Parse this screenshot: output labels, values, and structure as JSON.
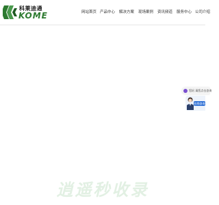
{
  "header": {
    "logo": {
      "cn_text": "科莱迪通",
      "en_text": "KOME",
      "colors": {
        "green": "#2d7a30",
        "dark": "#1a1a1a"
      }
    },
    "nav": [
      {
        "label": "网站首页"
      },
      {
        "label": "产品中心"
      },
      {
        "label": "解决方案"
      },
      {
        "label": "现场案例"
      },
      {
        "label": "资讯频道"
      },
      {
        "label": "服务中心"
      },
      {
        "label": "公司介绍"
      }
    ]
  },
  "float_widget": {
    "tip_text": "您好,请您点击咨询",
    "service_button": "在线咨询",
    "colors": {
      "button": "#2d6fd6",
      "tip_icon": "#7a4fd0"
    }
  },
  "watermark": {
    "text": "逍遥秒收录",
    "color": "#e2f0e3"
  }
}
